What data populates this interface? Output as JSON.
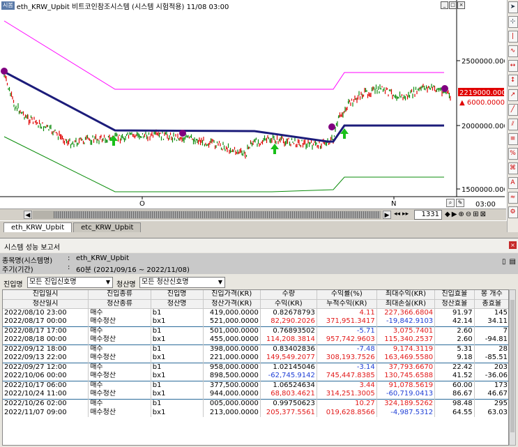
{
  "chart": {
    "badge": "시봄",
    "title": "eth_KRW_Upbit 비트코인참조시스템 (시스템 시험적용) 11/08 03:00",
    "y_labels": [
      "2500000.0000",
      "2000000.0000",
      "1500000.0000"
    ],
    "last_price": "2219000.0000",
    "diff_label": "6000.0000",
    "x_labels": [
      "O",
      "N"
    ],
    "time_label": "03:00",
    "bar_count": "1331",
    "tabs": [
      "eth_KRW_Upbit",
      "etc_KRW_Upbit"
    ],
    "colors": {
      "upper_band": "#ff00ff",
      "lower_band": "#0a8c0a",
      "trend_line": "#1c1c7a",
      "up_candle": "#e00000",
      "down_candle": "#0a8a0a",
      "buy_arrow": "#19c019",
      "signal_dot": "#800080",
      "price_tag": "#e00000"
    }
  },
  "report": {
    "title": "시스템 성능 보고서",
    "info": [
      {
        "key": "종목명(시스템명)",
        "sep": ":",
        "value": "eth_KRW_Upbit"
      },
      {
        "key": "주기(기간)",
        "sep": ":",
        "value": "60분 (2021/09/16 ~ 2022/11/08)"
      }
    ],
    "entry_filter_label": "진입명",
    "entry_filter_value": "모든 진입신호명",
    "exit_filter_label": "청산명",
    "exit_filter_value": "모든 청산신호명",
    "headers_top": [
      "진입일시",
      "진입종류",
      "진입명",
      "진입가격(KR)",
      "수량",
      "수익률(%)",
      "최대수익(KR)",
      "진입효율",
      "봉 개수"
    ],
    "headers_bottom": [
      "청산일시",
      "청산종류",
      "청산명",
      "청산가격(KR)",
      "수익(KR)",
      "누적수익(KR)",
      "최대손실(KR)",
      "청산효율",
      "총효율"
    ],
    "rows": [
      {
        "kind": "entry",
        "cells": [
          "2022/08/10 23:00",
          "매수",
          "b1",
          "419,000.0000",
          "0.82678793",
          "4.11",
          "227,366.6804",
          "91.97",
          "145"
        ]
      },
      {
        "kind": "exit",
        "cells": [
          "2022/08/17 00:00",
          "매수청산",
          "bx1",
          "521,000.0000",
          "82,290.2026",
          "371,951.3417",
          "-19,842.9103",
          "42.14",
          "34.11"
        ]
      },
      {
        "kind": "entry",
        "cells": [
          "2022/08/17 17:00",
          "매수",
          "b1",
          "501,000.0000",
          "0.76893502",
          "-5.71",
          "3,075.7401",
          "2.60",
          "7"
        ]
      },
      {
        "kind": "exit",
        "cells": [
          "2022/08/18 00:00",
          "매수청산",
          "bx1",
          "455,000.0000",
          "114,208.3814",
          "957,742.9603",
          "115,340.2537",
          "2.60",
          "-94.81"
        ]
      },
      {
        "kind": "entry",
        "cells": [
          "2022/09/12 18:00",
          "매수",
          "b1",
          "398,000.0000",
          "0.83402836",
          "-7.48",
          "9,174.3119",
          "5.31",
          "28"
        ]
      },
      {
        "kind": "exit",
        "cells": [
          "2022/09/13 22:00",
          "매수청산",
          "bx1",
          "221,000.0000",
          "149,549.2077",
          "308,193.7526",
          "163,469.5580",
          "9.18",
          "-85.51"
        ]
      },
      {
        "kind": "entry",
        "cells": [
          "2022/09/27 12:00",
          "매수",
          "b1",
          "958,000.0000",
          "1.02145046",
          "-3.14",
          "37,793.6670",
          "22.42",
          "203"
        ]
      },
      {
        "kind": "exit",
        "cells": [
          "2022/10/06 00:00",
          "매수청산",
          "bx1",
          "898,500.0000",
          "-62,745.9142",
          "745,447.8385",
          "130,745.6588",
          "41.52",
          "-36.06"
        ]
      },
      {
        "kind": "entry",
        "cells": [
          "2022/10/17 06:00",
          "매수",
          "b1",
          "377,500.0000",
          "1.06524634",
          "3.44",
          "91,078.5619",
          "60.00",
          "173"
        ]
      },
      {
        "kind": "exit",
        "cells": [
          "2022/10/24 11:00",
          "매수청산",
          "bx1",
          "944,000.0000",
          "68,803.4621",
          "314,251.3005",
          "-60,719.0413",
          "86.67",
          "46.67"
        ]
      },
      {
        "kind": "entry",
        "cells": [
          "2022/10/26 02:00",
          "매수",
          "b1",
          "005,000.0000",
          "0.99750623",
          "10.27",
          "324,189.5262",
          "98.48",
          "295"
        ]
      },
      {
        "kind": "exit",
        "cells": [
          "2022/11/07 09:00",
          "매수청산",
          "bx1",
          "213,000.0000",
          "205,377.5561",
          "019,628.8566",
          "-4,987.5312",
          "64.55",
          "63.03"
        ]
      }
    ]
  }
}
